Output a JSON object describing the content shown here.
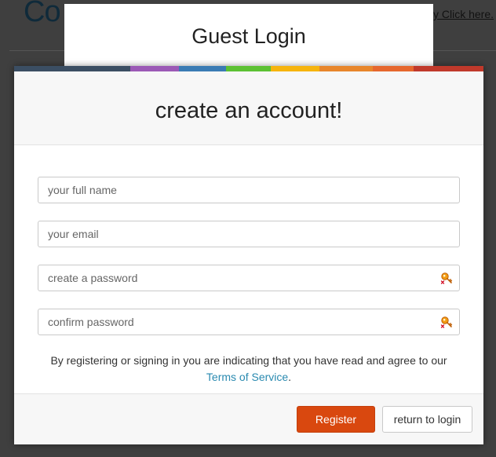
{
  "background": {
    "logo_text": "Co",
    "link_text": "y Click here."
  },
  "guest_card": {
    "title": "Guest Login"
  },
  "modal": {
    "rainbow_colors": [
      "#3b4e63",
      "#3b4e63",
      "#3b4e63",
      "#9b59b6",
      "#3a7bb4",
      "#5cc133",
      "#f1a31f",
      "#f5a623",
      "#e8792b",
      "#e0612e",
      "#c0392b"
    ],
    "title": "create an account!",
    "fields": {
      "full_name": {
        "placeholder": "your full name",
        "value": ""
      },
      "email": {
        "placeholder": "your email",
        "value": ""
      },
      "password": {
        "placeholder": "create a password",
        "value": ""
      },
      "confirm_password": {
        "placeholder": "confirm password",
        "value": ""
      }
    },
    "terms_text": "By registering or signing in you are indicating that you have read and agree to our",
    "terms_link": "Terms of Service",
    "terms_period": ".",
    "register_label": "Register",
    "return_label": "return to login",
    "register_color": "#d9480f",
    "key_icon": "key-icon"
  }
}
